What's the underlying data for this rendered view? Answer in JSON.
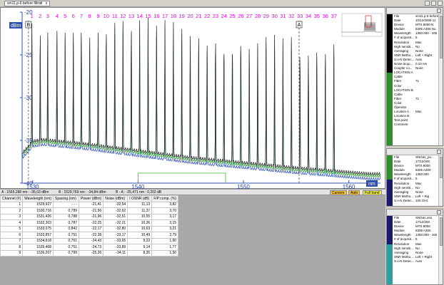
{
  "window": {
    "tab_label": "sm11.p-6 before filtrati",
    "tab_close": "x"
  },
  "chart_data": {
    "type": "line",
    "xlabel": "nm",
    "ylabel": "dBm",
    "xlim": [
      1529,
      1563
    ],
    "ylim": [
      -40,
      -20
    ],
    "x_ticks": [
      1530,
      1540,
      1550,
      1560
    ],
    "y_ticks": [
      -20,
      -25,
      -30,
      -35,
      -40
    ],
    "grid": false,
    "channel_labels": [
      "1",
      "2",
      "3",
      "4",
      "5",
      "6",
      "7",
      "8",
      "9",
      "10",
      "11",
      "12",
      "13",
      "14",
      "15",
      "16",
      "17",
      "18",
      "19",
      "20",
      "21",
      "22",
      "23",
      "24",
      "25",
      "26",
      "27",
      "28",
      "29",
      "30",
      "31",
      "32",
      "33",
      "34",
      "35",
      "36",
      "37"
    ],
    "channel_wavelengths": [
      1529.927,
      1530.716,
      1531.426,
      1532.303,
      1533.075,
      1533.857,
      1534.618,
      1535.408,
      1536.207,
      1536.98,
      1537.79,
      1538.57,
      1539.36,
      1540.15,
      1540.95,
      1541.75,
      1542.55,
      1543.35,
      1544.15,
      1544.95,
      1545.75,
      1546.55,
      1547.35,
      1548.15,
      1548.95,
      1549.75,
      1550.55,
      1551.35,
      1552.15,
      1552.95,
      1553.75,
      1554.55,
      1555.36,
      1556.16,
      1556.96,
      1557.77,
      1558.58
    ],
    "peaks_dbm": [
      -21.0,
      -21.6,
      -22.3,
      -22.2,
      -22.0,
      -22.4,
      -21.3,
      -22.8,
      -21.8,
      -20.8,
      -21.2,
      -21.0,
      -20.3,
      -20.8,
      -20.6,
      -21.6,
      -20.9,
      -21.0,
      -21.6,
      -22.2,
      -22.1,
      -22.6,
      -21.8,
      -22.6,
      -22.6,
      -22.1,
      -23.0,
      -22.7,
      -22.3,
      -22.3,
      -22.9,
      -22.9,
      -23.5,
      -23.8,
      -23.8,
      -23.6,
      -23.8
    ],
    "noise_floor": {
      "x": [
        1529,
        1530,
        1531,
        1535,
        1540,
        1545,
        1550,
        1555,
        1560,
        1562
      ],
      "y": [
        -36.6,
        -35.2,
        -35.0,
        -35.5,
        -36.3,
        -37.1,
        -37.7,
        -38.3,
        -38.8,
        -39.0
      ]
    },
    "marker_a": {
      "label": "A",
      "x": 1555.28
    },
    "marker_b": {
      "label": "B",
      "x": 1529.6
    },
    "marker_span": {
      "x1": 1540,
      "x2": 1548.3
    }
  },
  "statusbar": {
    "a_readout": "A : 1555,288 nm : -35,03 dBm",
    "b_readout": "B : 1529,769 nm : -34,84 dBm",
    "diff_readout": "B - A : -25,471 nm : 0,202 dB",
    "cursors_label": "Cursors",
    "auto_label": "Auto",
    "fullband_label": "Full band"
  },
  "table": {
    "headers": [
      "Channel (#)",
      "Wavelength (nm)",
      "Spacing (nm)",
      "Power (dBm)",
      "Noise (dBm)",
      "I OSNR (dB)",
      "F/P comp. (%)"
    ],
    "rows": [
      [
        "1",
        "1529,927",
        "- - -",
        "-21,41",
        "-32,54",
        "11,13",
        "3,82"
      ],
      [
        "2",
        "1530,716",
        "0,789",
        "-21,56",
        "-32,62",
        "11,37",
        "3,70"
      ],
      [
        "3",
        "1531,426",
        "0,788",
        "-21,96",
        "-32,51",
        "10,55",
        "3,17"
      ],
      [
        "4",
        "1532,303",
        "0,787",
        "-22,25",
        "-32,21",
        "10,36",
        "3,15"
      ],
      [
        "5",
        "1533,075",
        "0,842",
        "-22,17",
        "-32,80",
        "10,63",
        "3,21"
      ],
      [
        "6",
        "1533,857",
        "0,751",
        "-22,38",
        "-33,17",
        "10,49",
        "2,79"
      ],
      [
        "7",
        "1534,618",
        "0,761",
        "-24,43",
        "-33,65",
        "9,22",
        "1,90"
      ],
      [
        "8",
        "1535,408",
        "0,751",
        "-24,73",
        "-33,89",
        "9,14",
        "1,77"
      ],
      [
        "9",
        "1536,207",
        "0,799",
        "-25,26",
        "-34,11",
        "8,35",
        "1,50"
      ]
    ]
  },
  "panes": [
    {
      "fields": [
        [
          "File",
          "sm11.p-6 before"
        ],
        [
          "Date",
          "10/12/2009 11"
        ],
        [
          "Device",
          "MTS 8000 N"
        ],
        [
          "Module",
          "8305 A300 Nu"
        ],
        [
          "Wavelength",
          "1350.000 - 165"
        ],
        [
          "# of acquisit...",
          "5"
        ],
        [
          "Resolution",
          "Max"
        ],
        [
          "High sensiti...",
          "No"
        ],
        [
          "Averaging",
          "None"
        ],
        [
          "SNR Metho...",
          "Left + Right"
        ],
        [
          "S.n-N Detec...",
          "Auto"
        ],
        [
          "Noise acqu...",
          "0.10 nm"
        ],
        [
          "Coupler co...",
          "None"
        ],
        [
          "LOCATION A",
          ""
        ],
        [
          "Cable",
          ""
        ],
        [
          "Fiber",
          "71"
        ],
        [
          "Color",
          ""
        ],
        [
          "LOCATION B",
          ""
        ],
        [
          "Cable",
          ""
        ],
        [
          "Fiber",
          "71"
        ],
        [
          "Color",
          ""
        ],
        [
          "Operator",
          ""
        ],
        [
          "Location A",
          "Max"
        ],
        [
          "Location B",
          ""
        ],
        [
          "Test point",
          ""
        ],
        [
          "Comment",
          ""
        ]
      ]
    },
    {
      "fields": [
        [
          "File",
          "SNGas_pu..."
        ],
        [
          "Date",
          "17/12/200"
        ],
        [
          "Device",
          "MTS 8000"
        ],
        [
          "Module",
          "8305 A300"
        ],
        [
          "Wavelength",
          "1350.000"
        ],
        [
          "# of acquisit...",
          "5"
        ],
        [
          "Resolution",
          "Max"
        ],
        [
          "High sensiti...",
          "No"
        ],
        [
          "Averaging",
          "None"
        ],
        [
          "SNR Metho...",
          "Left + Rig"
        ],
        [
          "S.n-N Detec...",
          "100 GHz"
        ]
      ]
    },
    {
      "fields": [
        [
          "File",
          "SNGas.osa"
        ],
        [
          "Date",
          "17/12/200"
        ],
        [
          "Device",
          "MTS 8000"
        ],
        [
          "Module",
          "8305 A300"
        ],
        [
          "Wavelength",
          "1350.000 - 165"
        ],
        [
          "# of acquisit...",
          "5"
        ],
        [
          "Resolution",
          "Max"
        ],
        [
          "High sensiti...",
          "No"
        ],
        [
          "Averaging",
          "None"
        ],
        [
          "SNR Metho...",
          "Left + Right"
        ],
        [
          "S.n-N Detec...",
          "Auto"
        ]
      ]
    }
  ],
  "colors": {
    "trace_dark": "#303030",
    "trace_green": "#2c9a2c",
    "trace_blue": "#3a5ec0",
    "channel_label": "#e000e0",
    "axis_label": "#2040a0",
    "pane_green": "#2f8f2f",
    "pane_navy": "#1a1a6e",
    "pane_teal": "#2aa0a0"
  }
}
